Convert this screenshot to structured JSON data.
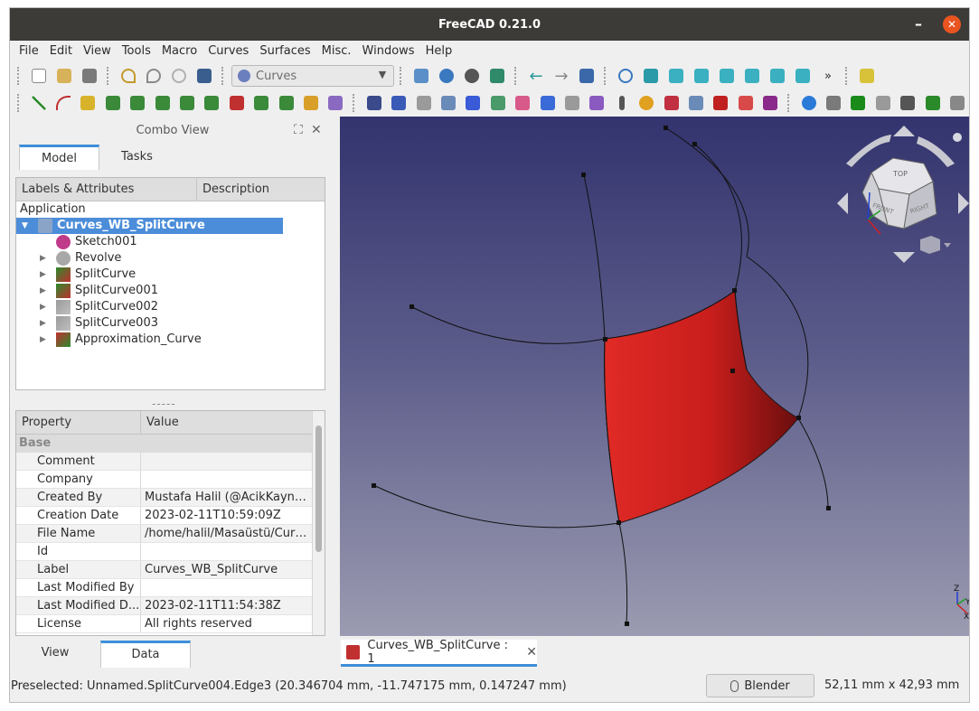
{
  "window": {
    "title": "FreeCAD 0.21.0",
    "minimize": "–",
    "close": "✕"
  },
  "menu": [
    "File",
    "Edit",
    "View",
    "Tools",
    "Macro",
    "Curves",
    "Surfaces",
    "Misc.",
    "Windows",
    "Help"
  ],
  "toolbar": {
    "workbench": "Curves",
    "overflow": "»"
  },
  "combo_view": {
    "title": "Combo View",
    "tabs": [
      "Model",
      "Tasks"
    ],
    "active_tab": "Model",
    "tree": {
      "columns": [
        "Labels & Attributes",
        "Description"
      ],
      "root": "Application",
      "items": [
        {
          "label": "Curves_WB_SplitCurve",
          "selected": true,
          "icon": "document-icon"
        },
        {
          "label": "Sketch001",
          "icon": "sketch-icon"
        },
        {
          "label": "Revolve",
          "icon": "revolve-icon"
        },
        {
          "label": "SplitCurve",
          "icon": "splitcurve-icon"
        },
        {
          "label": "SplitCurve001",
          "icon": "splitcurve-icon"
        },
        {
          "label": "SplitCurve002",
          "icon": "splitcurve-hidden-icon"
        },
        {
          "label": "SplitCurve003",
          "icon": "splitcurve-hidden-icon"
        },
        {
          "label": "Approximation_Curve",
          "icon": "approximation-icon"
        }
      ]
    },
    "splitter": "-----",
    "properties": {
      "columns": [
        "Property",
        "Value"
      ],
      "group": "Base",
      "rows": [
        {
          "key": "Comment",
          "value": ""
        },
        {
          "key": "Company",
          "value": ""
        },
        {
          "key": "Created By",
          "value": "Mustafa Halil (@AcikKaynakci)"
        },
        {
          "key": "Creation Date",
          "value": "2023-02-11T10:59:09Z"
        },
        {
          "key": "File Name",
          "value": "/home/halil/Masaüstü/Curve..."
        },
        {
          "key": "Id",
          "value": ""
        },
        {
          "key": "Label",
          "value": "Curves_WB_SplitCurve"
        },
        {
          "key": "Last Modified By",
          "value": ""
        },
        {
          "key": "Last Modified D...",
          "value": "2023-02-11T11:54:38Z"
        },
        {
          "key": "License",
          "value": "All rights reserved"
        }
      ]
    },
    "bottom_tabs": [
      "View",
      "Data"
    ],
    "active_bottom_tab": "Data"
  },
  "document_tab": {
    "label": "Curves_WB_SplitCurve : 1",
    "close": "✕"
  },
  "navcube": {
    "faces": [
      "TOP",
      "FRONT",
      "RIGHT"
    ]
  },
  "axis_labels": [
    "Z",
    "Y",
    "X"
  ],
  "colors": {
    "accent": "#3d8fd8",
    "selection": "#4c8dd9",
    "surface": "#d9201e",
    "titlebar": "#3c3b37",
    "close": "#e95420"
  },
  "statusbar": {
    "message": "Preselected: Unnamed.SplitCurve004.Edge3 (20.346704 mm, -11.747175 mm, 0.147247 mm)",
    "navigation": "Blender",
    "dimensions": "52,11 mm x 42,93 mm"
  }
}
